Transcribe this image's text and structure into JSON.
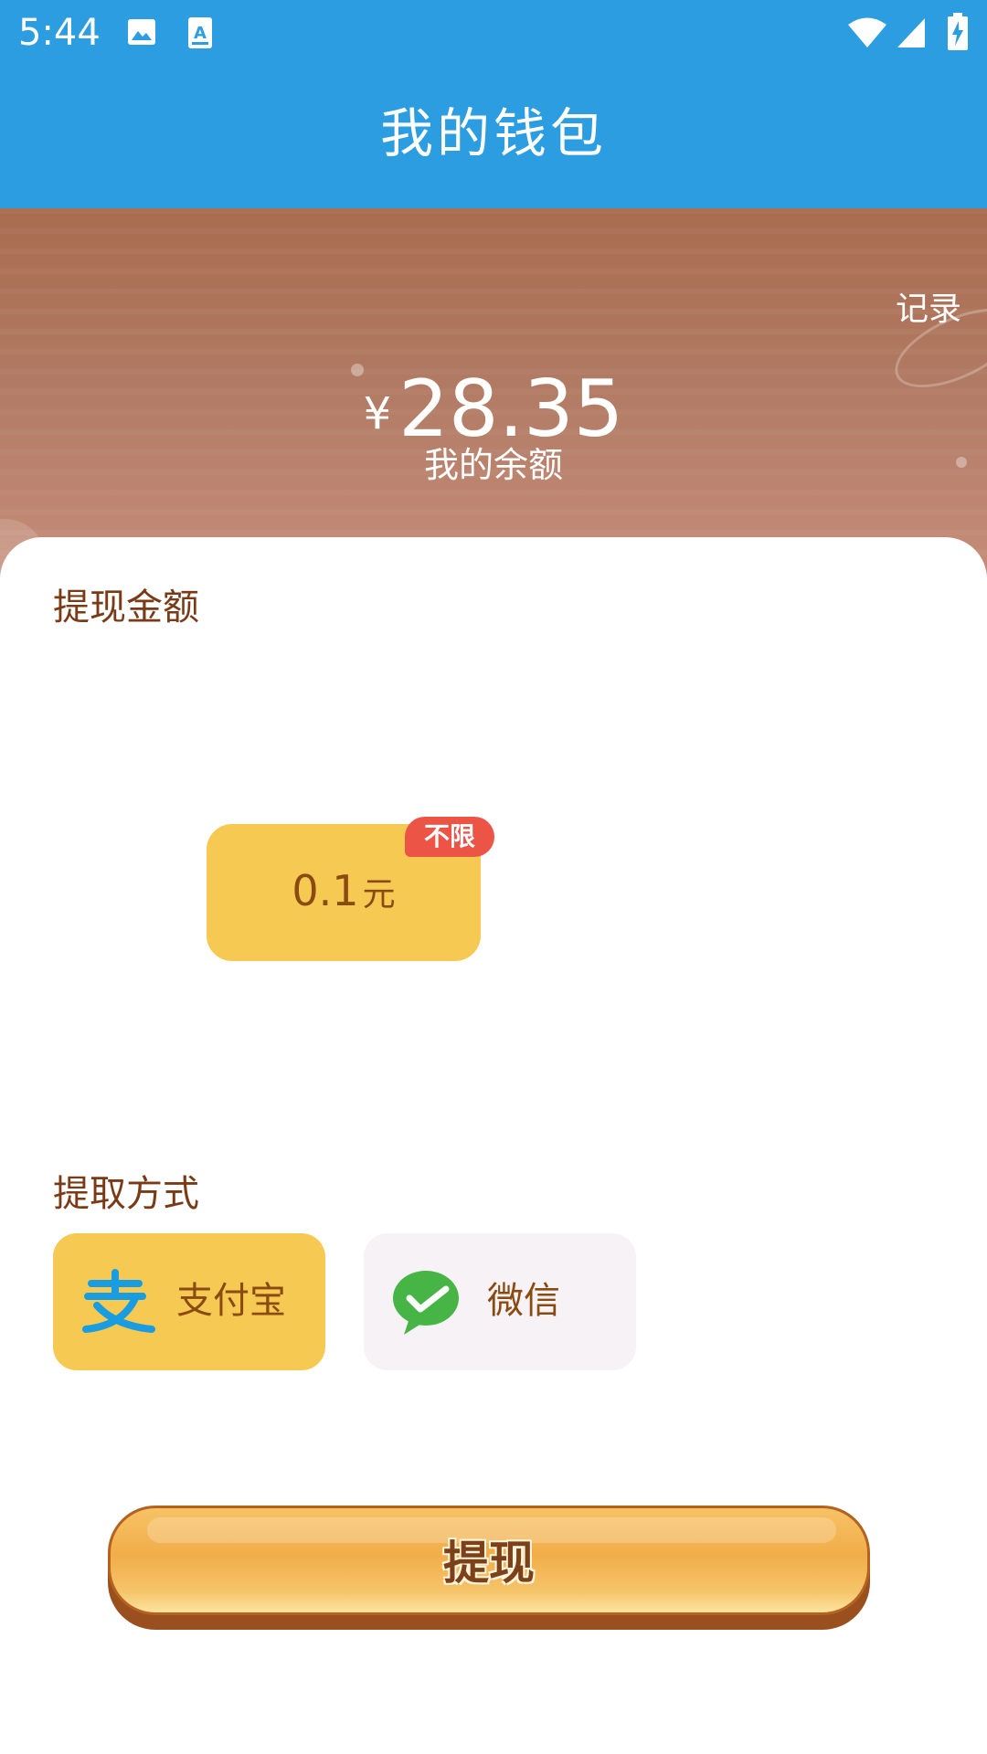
{
  "status_bar": {
    "time": "5:44",
    "icons": [
      "image-icon",
      "text-a-icon",
      "wifi-icon",
      "cell-signal-icon",
      "battery-charging-icon"
    ]
  },
  "app_bar": {
    "title": "我的钱包"
  },
  "balance": {
    "record_link": "记录",
    "currency_symbol": "¥",
    "amount": "28.35",
    "label": "我的余额"
  },
  "withdraw_amount": {
    "section_title": "提现金额",
    "options": [
      {
        "value": "0.1",
        "unit": "元",
        "badge": "不限",
        "selected": true
      }
    ]
  },
  "payment_method": {
    "section_title": "提取方式",
    "options": [
      {
        "label": "支付宝",
        "icon": "alipay-icon",
        "selected": true
      },
      {
        "label": "微信",
        "icon": "wechat-icon",
        "selected": false
      }
    ]
  },
  "withdraw_button": {
    "label": "提现"
  },
  "colors": {
    "app_bar": "#2b9de0",
    "selected_option": "#f6ca52",
    "unselected_option": "#f6f2f6",
    "badge": "#ec5446",
    "label_text": "#7a3a16"
  }
}
